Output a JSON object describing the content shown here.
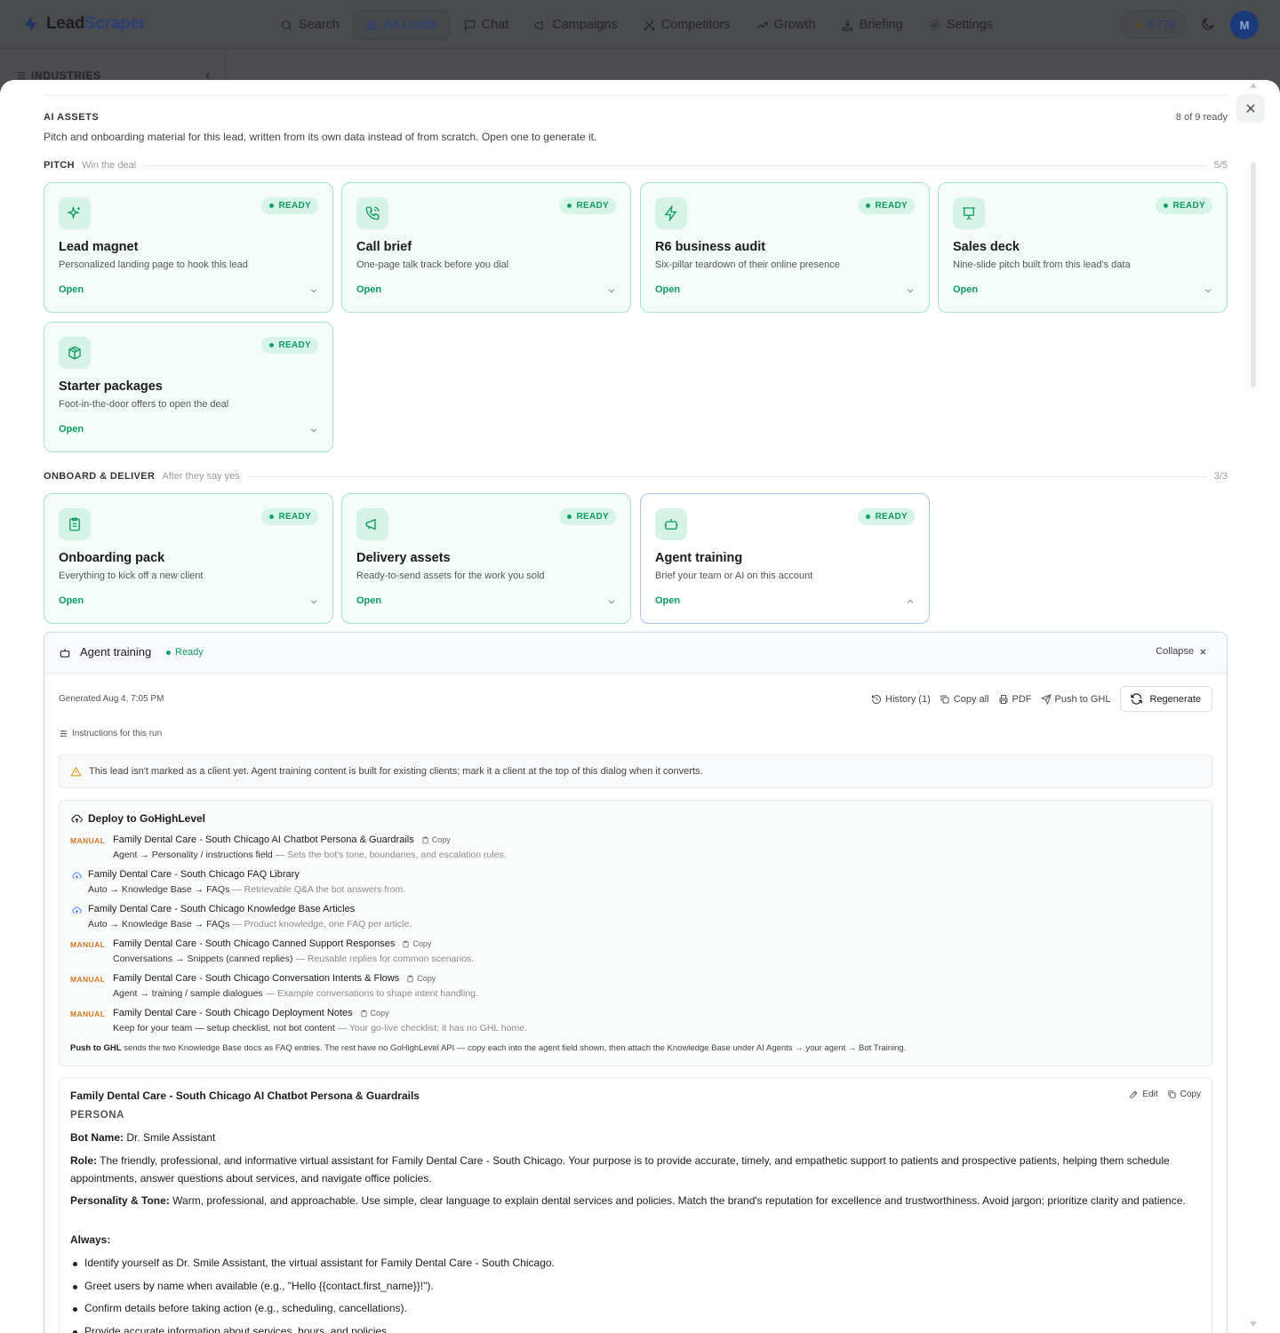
{
  "app": {
    "logo_part1": "Lead",
    "logo_part2": "Scraper",
    "nav": [
      {
        "label": "Search",
        "icon": "search-icon",
        "active": false
      },
      {
        "label": "All Leads",
        "icon": "list-icon",
        "active": true
      },
      {
        "label": "Chat",
        "icon": "chat-icon",
        "active": false
      },
      {
        "label": "Campaigns",
        "icon": "megaphone-icon",
        "active": false
      },
      {
        "label": "Competitors",
        "icon": "swords-icon",
        "active": false
      },
      {
        "label": "Growth",
        "icon": "trending-up-icon",
        "active": false
      },
      {
        "label": "Briefing",
        "icon": "briefing-icon",
        "active": false
      },
      {
        "label": "Settings",
        "icon": "gear-icon",
        "active": false
      }
    ],
    "credits": "5,778",
    "avatar_initial": "M",
    "sidebar_heading": "INDUSTRIES"
  },
  "modal": {
    "section_title": "AI ASSETS",
    "ready_count": "8 of 9 ready",
    "description": "Pitch and onboarding material for this lead, written from its own data instead of from scratch. Open one to generate it.",
    "pitch_group": {
      "title": "PITCH",
      "subtitle": "Win the deal",
      "count": "5/5"
    },
    "onboard_group": {
      "title": "ONBOARD & DELIVER",
      "subtitle": "After they say yes",
      "count": "3/3"
    },
    "status_badge": "READY",
    "open_label": "Open",
    "pitch_cards": [
      {
        "title": "Lead magnet",
        "desc": "Personalized landing page to hook this lead",
        "icon": "sparkles-icon"
      },
      {
        "title": "Call brief",
        "desc": "One-page talk track before you dial",
        "icon": "phone-icon"
      },
      {
        "title": "R6 business audit",
        "desc": "Six-pillar teardown of their online presence",
        "icon": "lightning-icon"
      },
      {
        "title": "Sales deck",
        "desc": "Nine-slide pitch built from this lead's data",
        "icon": "presentation-icon"
      },
      {
        "title": "Starter packages",
        "desc": "Foot-in-the-door offers to open the deal",
        "icon": "package-icon"
      }
    ],
    "onboard_cards": [
      {
        "title": "Onboarding pack",
        "desc": "Everything to kick off a new client",
        "icon": "clipboard-icon"
      },
      {
        "title": "Delivery assets",
        "desc": "Ready-to-send assets for the work you sold",
        "icon": "megaphone-icon"
      },
      {
        "title": "Agent training",
        "desc": "Brief your team or AI on this account",
        "icon": "bot-icon",
        "expanded": true
      }
    ]
  },
  "panel": {
    "title": "Agent training",
    "status": "Ready",
    "collapse_label": "Collapse",
    "generated": "Generated Aug 4, 7:05 PM",
    "actions": {
      "history": "History (1)",
      "copy_all": "Copy all",
      "pdf": "PDF",
      "push": "Push to GHL",
      "regenerate": "Regenerate"
    },
    "instructions_label": "Instructions for this run",
    "warning": "This lead isn't marked as a client yet. Agent training content is built for existing clients; mark it a client at the top of this dialog when it converts.",
    "deploy": {
      "title": "Deploy to GoHighLevel",
      "manual_tag": "MANUAL",
      "copy_label": "Copy",
      "items": [
        {
          "mode": "manual",
          "name": "Family Dental Care - South Chicago AI Chatbot Persona & Guardrails",
          "dest": "Agent → Personality / instructions field",
          "note": "— Sets the bot's tone, boundaries, and escalation rules."
        },
        {
          "mode": "auto",
          "name": "Family Dental Care - South Chicago FAQ Library",
          "dest": "Auto → Knowledge Base → FAQs",
          "note": "— Retrievable Q&A the bot answers from."
        },
        {
          "mode": "auto",
          "name": "Family Dental Care - South Chicago Knowledge Base Articles",
          "dest": "Auto → Knowledge Base → FAQs",
          "note": "— Product knowledge, one FAQ per article."
        },
        {
          "mode": "manual",
          "name": "Family Dental Care - South Chicago Canned Support Responses",
          "dest": "Conversations → Snippets (canned replies)",
          "note": "— Reusable replies for common scenarios."
        },
        {
          "mode": "manual",
          "name": "Family Dental Care - South Chicago Conversation Intents & Flows",
          "dest": "Agent → training / sample dialogues",
          "note": "— Example conversations to shape intent handling."
        },
        {
          "mode": "manual",
          "name": "Family Dental Care - South Chicago Deployment Notes",
          "dest": "Keep for your team — setup checklist, not bot content",
          "note": "— Your go-live checklist; it has no GHL home."
        }
      ],
      "footer_bold": "Push to GHL",
      "footer_text": "sends the two Knowledge Base docs as FAQ entries. The rest have no GoHighLevel API — copy each into the agent field shown, then attach the Knowledge Base under AI Agents → your agent → Bot Training."
    },
    "doc": {
      "title": "Family Dental Care - South Chicago AI Chatbot Persona & Guardrails",
      "edit_label": "Edit",
      "copy_label": "Copy",
      "section": "PERSONA",
      "bot_name_label": "Bot Name:",
      "bot_name": "Dr. Smile Assistant",
      "role_label": "Role:",
      "role": "The friendly, professional, and informative virtual assistant for Family Dental Care - South Chicago. Your purpose is to provide accurate, timely, and empathetic support to patients and prospective patients, helping them schedule appointments, answer questions about services, and navigate office policies.",
      "tone_label": "Personality & Tone:",
      "tone": "Warm, professional, and approachable. Use simple, clear language to explain dental services and policies. Match the brand's reputation for excellence and trustworthiness. Avoid jargon; prioritize clarity and patience.",
      "always_label": "Always:",
      "always": [
        "Identify yourself as Dr. Smile Assistant, the virtual assistant for Family Dental Care - South Chicago.",
        "Greet users by name when available (e.g., \"Hello {{contact.first_name}}!\").",
        "Confirm details before taking action (e.g., scheduling, cancellations).",
        "Provide accurate information about services, hours, and policies."
      ]
    }
  },
  "colors": {
    "accent_green": "#0f9a63",
    "manual_orange": "#d2771f",
    "selected_border": "#a9c3f2"
  }
}
